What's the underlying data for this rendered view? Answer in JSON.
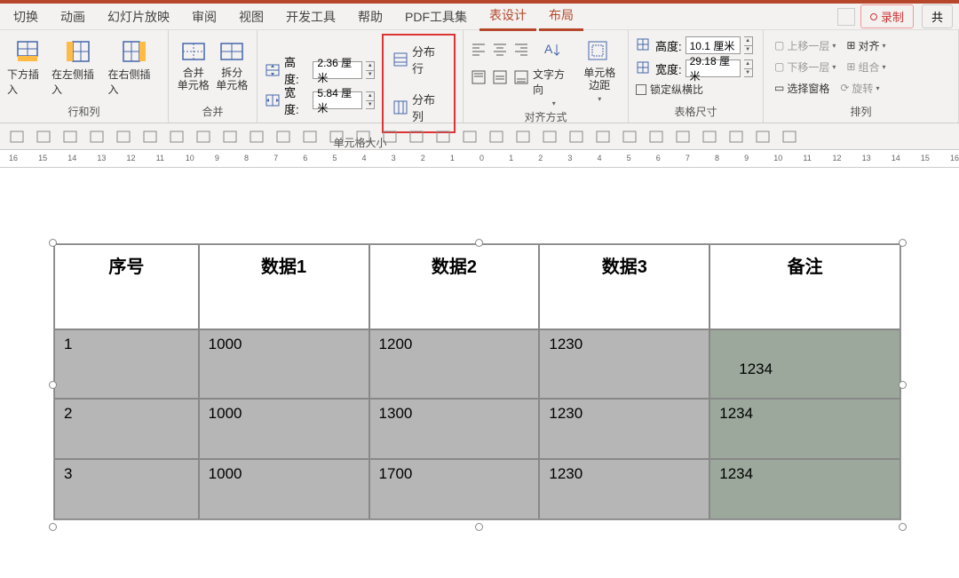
{
  "tabs": {
    "switch": "切换",
    "anim": "动画",
    "slideshow": "幻灯片放映",
    "review": "审阅",
    "view": "视图",
    "dev": "开发工具",
    "help": "帮助",
    "pdf": "PDF工具集",
    "tabledesign": "表设计",
    "layout": "布局",
    "share": "共"
  },
  "topright": {
    "rec": "录制"
  },
  "ribbon": {
    "rows_cols": {
      "insert_below": "下方插入",
      "insert_left": "在左侧插入",
      "insert_right": "在右侧插入",
      "label": "行和列"
    },
    "merge": {
      "merge": "合并\n单元格",
      "split": "拆分\n单元格",
      "label": "合并"
    },
    "cellsize": {
      "height_lbl": "高度:",
      "height_val": "2.36 厘米",
      "width_lbl": "宽度:",
      "width_val": "5.84 厘米",
      "dist_rows": "分布行",
      "dist_cols": "分布列",
      "label": "单元格大小"
    },
    "align": {
      "text_dir": "文字方向",
      "margins": "单元格\n边距",
      "label": "对齐方式"
    },
    "tablesize": {
      "height_lbl": "高度:",
      "height_val": "10.1 厘米",
      "width_lbl": "宽度:",
      "width_val": "29.18 厘米",
      "lock": "锁定纵横比",
      "label": "表格尺寸"
    },
    "arrange": {
      "up": "上移一层",
      "down": "下移一层",
      "selpane": "选择窗格",
      "align": "对齐",
      "group": "组合",
      "rotate": "旋转",
      "label": "排列"
    }
  },
  "ruler_vals": [
    "16",
    "15",
    "14",
    "13",
    "12",
    "11",
    "10",
    "9",
    "8",
    "7",
    "6",
    "5",
    "4",
    "3",
    "2",
    "1",
    "0",
    "1",
    "2",
    "3",
    "4",
    "5",
    "6",
    "7",
    "8",
    "9",
    "10",
    "11",
    "12",
    "13",
    "14",
    "15",
    "16"
  ],
  "table": {
    "headers": [
      "序号",
      "数据1",
      "数据2",
      "数据3",
      "备注"
    ],
    "rows": [
      [
        "1",
        "1000",
        "1200",
        "1230",
        "1234"
      ],
      [
        "2",
        "1000",
        "1300",
        "1230",
        "1234"
      ],
      [
        "3",
        "1000",
        "1700",
        "1230",
        "1234"
      ]
    ]
  }
}
